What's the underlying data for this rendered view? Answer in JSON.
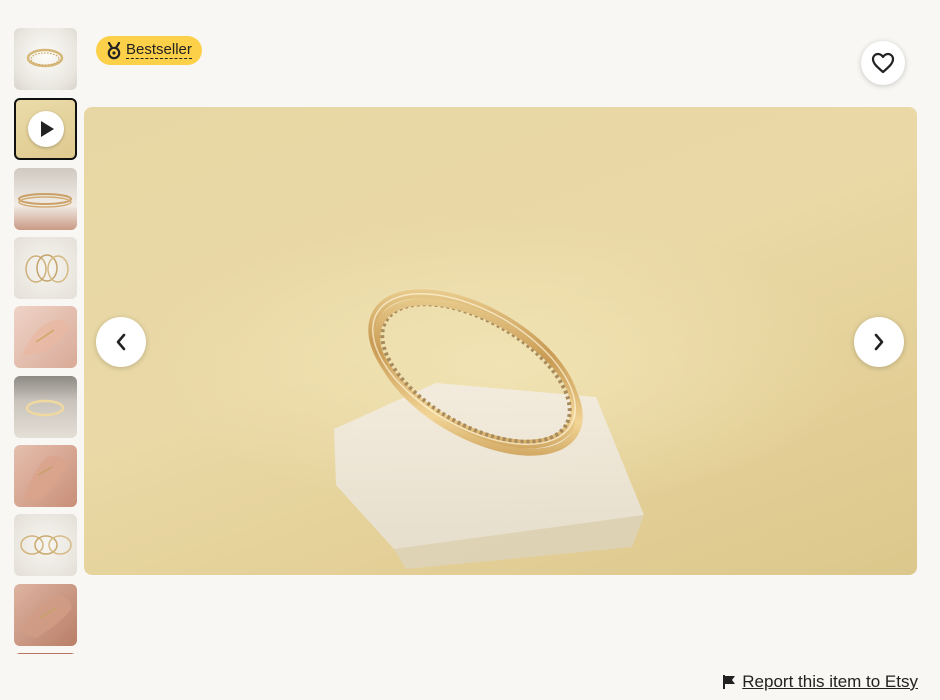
{
  "badge": {
    "label": "Bestseller",
    "icon": "medal-icon"
  },
  "favorite": {
    "icon": "heart-outline-icon"
  },
  "viewer": {
    "image": "gold-ring-on-stand",
    "prev_icon": "chevron-left-icon",
    "next_icon": "chevron-right-icon"
  },
  "thumbnails": [
    {
      "name": "thumb-ring-top",
      "kind": "image"
    },
    {
      "name": "thumb-video",
      "kind": "video",
      "active": true
    },
    {
      "name": "thumb-ring-side",
      "kind": "image"
    },
    {
      "name": "thumb-rings-stack",
      "kind": "image"
    },
    {
      "name": "thumb-hand-rings",
      "kind": "image"
    },
    {
      "name": "thumb-ring-closeup",
      "kind": "image"
    },
    {
      "name": "thumb-hand-shoulder",
      "kind": "image"
    },
    {
      "name": "thumb-three-rings",
      "kind": "image"
    },
    {
      "name": "thumb-hand-arm",
      "kind": "image"
    },
    {
      "name": "thumb-partial",
      "kind": "image"
    }
  ],
  "report": {
    "label": "Report this item to Etsy",
    "icon": "flag-icon"
  }
}
